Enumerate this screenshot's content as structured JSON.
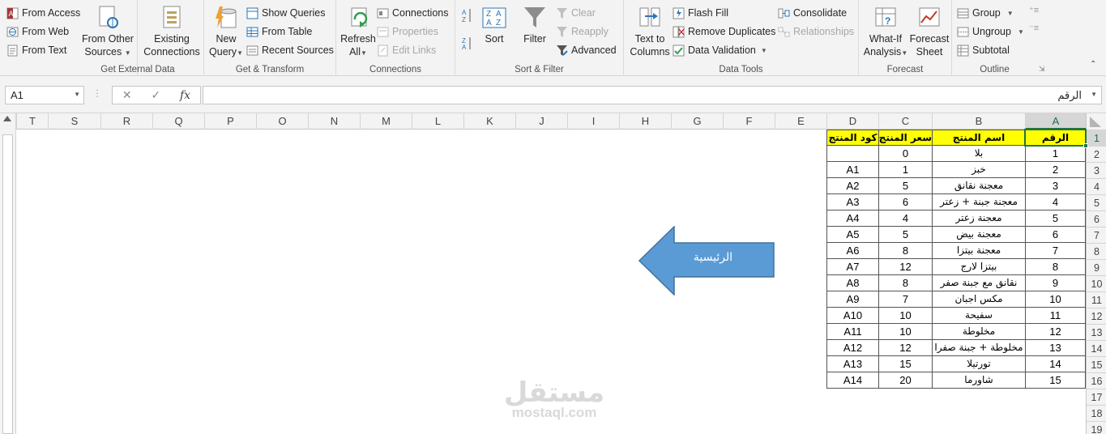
{
  "ribbon": {
    "get_external": {
      "label": "Get External Data",
      "from_access": "From Access",
      "from_web": "From Web",
      "from_text": "From Text",
      "from_other_1": "From Other",
      "from_other_2": "Sources",
      "existing_1": "Existing",
      "existing_2": "Connections"
    },
    "get_transform": {
      "label": "Get & Transform",
      "new_query_1": "New",
      "new_query_2": "Query",
      "show_queries": "Show Queries",
      "from_table": "From Table",
      "recent_sources": "Recent Sources"
    },
    "connections": {
      "label": "Connections",
      "refresh_1": "Refresh",
      "refresh_2": "All",
      "connections": "Connections",
      "properties": "Properties",
      "edit_links": "Edit Links"
    },
    "sort_filter": {
      "label": "Sort & Filter",
      "sort": "Sort",
      "filter": "Filter",
      "clear": "Clear",
      "reapply": "Reapply",
      "advanced": "Advanced"
    },
    "data_tools": {
      "label": "Data Tools",
      "text_to_columns_1": "Text to",
      "text_to_columns_2": "Columns",
      "flash_fill": "Flash Fill",
      "remove_duplicates": "Remove Duplicates",
      "data_validation": "Data Validation",
      "consolidate": "Consolidate",
      "relationships": "Relationships"
    },
    "forecast": {
      "label": "Forecast",
      "what_if_1": "What-If",
      "what_if_2": "Analysis",
      "forecast_sheet_1": "Forecast",
      "forecast_sheet_2": "Sheet"
    },
    "outline": {
      "label": "Outline",
      "group": "Group",
      "ungroup": "Ungroup",
      "subtotal": "Subtotal"
    }
  },
  "formula_bar": {
    "name_box": "A1",
    "fx": "fx",
    "value": "الرقم"
  },
  "columns": [
    "T",
    "S",
    "R",
    "Q",
    "P",
    "O",
    "N",
    "M",
    "L",
    "K",
    "J",
    "I",
    "H",
    "G",
    "F",
    "E",
    "D",
    "C",
    "B",
    "A"
  ],
  "rows": [
    "1",
    "2",
    "3",
    "4",
    "5",
    "6",
    "7",
    "8",
    "9",
    "10",
    "11",
    "12",
    "13",
    "14",
    "15",
    "16",
    "17",
    "18",
    "19"
  ],
  "table": {
    "headers": {
      "a": "الرقم",
      "b": "اسم المنتج",
      "c": "سعر المنتج",
      "d": "كود المنتج"
    },
    "rows": [
      {
        "a": "1",
        "b": "بلا",
        "c": "0",
        "d": ""
      },
      {
        "a": "2",
        "b": "خبز",
        "c": "1",
        "d": "A1"
      },
      {
        "a": "3",
        "b": "معجنة نقانق",
        "c": "5",
        "d": "A2"
      },
      {
        "a": "4",
        "b": "معجنة جبنة + زعتر",
        "c": "6",
        "d": "A3"
      },
      {
        "a": "5",
        "b": "معجنة زعتر",
        "c": "4",
        "d": "A4"
      },
      {
        "a": "6",
        "b": "معجنة بيض",
        "c": "5",
        "d": "A5"
      },
      {
        "a": "7",
        "b": "معجنة بيتزا",
        "c": "8",
        "d": "A6"
      },
      {
        "a": "8",
        "b": "بيتزا لارج",
        "c": "12",
        "d": "A7"
      },
      {
        "a": "9",
        "b": "نقانق مع جبنة صفر",
        "c": "8",
        "d": "A8"
      },
      {
        "a": "10",
        "b": "مكس اجبان",
        "c": "7",
        "d": "A9"
      },
      {
        "a": "11",
        "b": "سفيحة",
        "c": "10",
        "d": "A10"
      },
      {
        "a": "12",
        "b": "مخلوطة",
        "c": "10",
        "d": "A11"
      },
      {
        "a": "13",
        "b": "مخلوطة + جبنة صفرا",
        "c": "12",
        "d": "A12"
      },
      {
        "a": "14",
        "b": "تورتيلا",
        "c": "15",
        "d": "A13"
      },
      {
        "a": "15",
        "b": "شاورما",
        "c": "20",
        "d": "A14"
      }
    ]
  },
  "shape": {
    "label": "الرئيسية",
    "color": "#5b9bd5"
  },
  "watermark": {
    "ar": "مستقل",
    "en": "mostaql.com"
  },
  "colors": {
    "excel_green": "#217346",
    "header_fill": "#ffff00"
  }
}
